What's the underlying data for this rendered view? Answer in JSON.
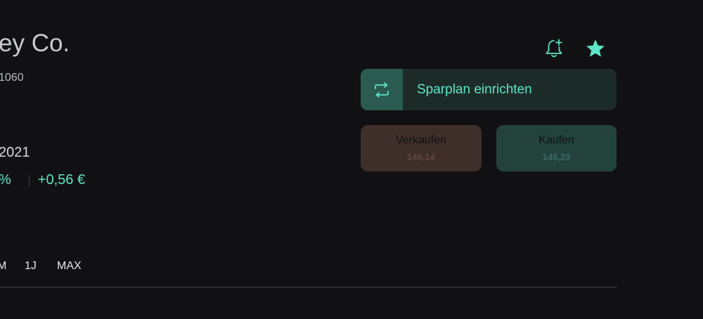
{
  "stock": {
    "name": "ey Co.",
    "isin": "1060",
    "date": "2021",
    "change_percent": "%",
    "change_absolute": "+0,56 €"
  },
  "time_ranges": [
    "M",
    "1J",
    "MAX"
  ],
  "actions": {
    "savings_plan_label": "Sparplan einrichten",
    "sell_label": "Verkaufen",
    "sell_price": "146,14",
    "buy_label": "Kaufen",
    "buy_price": "146,20"
  },
  "icons": {
    "bell": "bell-plus-icon",
    "star": "star-icon",
    "savings": "repeat-icon"
  },
  "colors": {
    "accent": "#5ce6c8",
    "background": "#111113",
    "sell": "#3f2f2b",
    "buy": "#23423c",
    "savings_bg": "#1d2b28"
  }
}
